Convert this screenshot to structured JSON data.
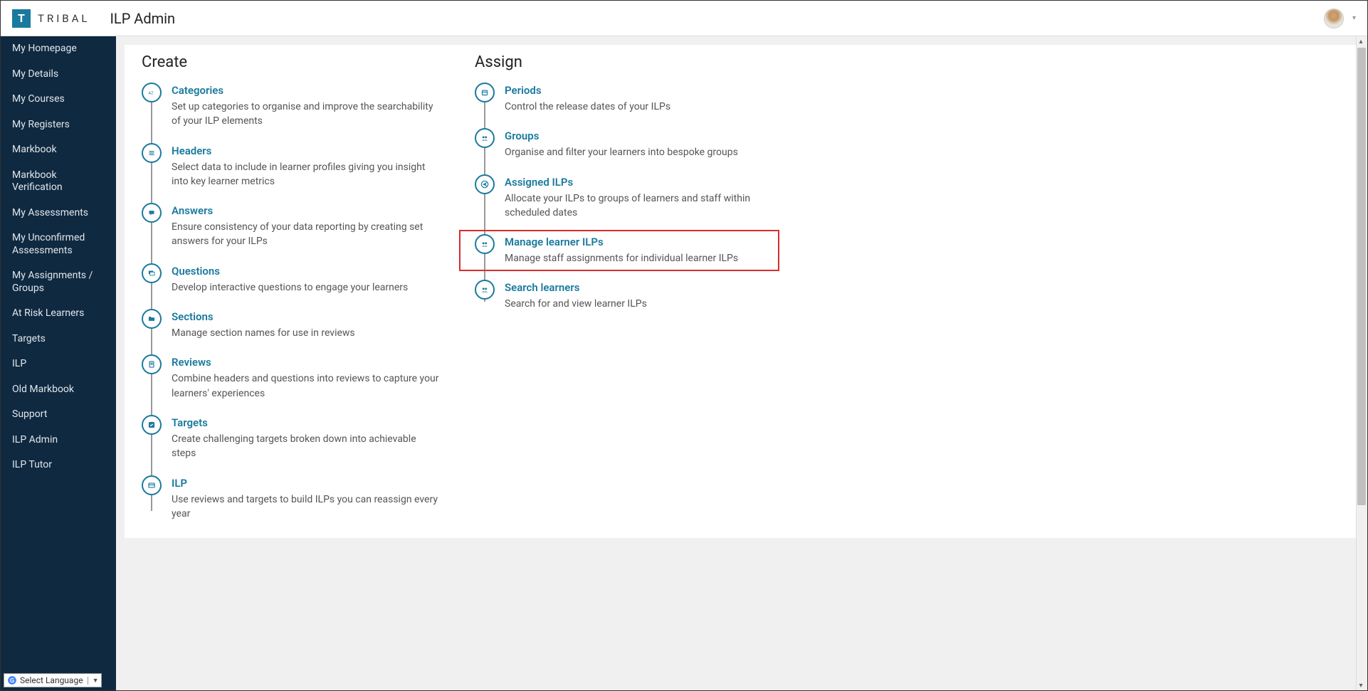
{
  "header": {
    "logo_letter": "T",
    "logo_text": "TRIBAL",
    "page_title": "ILP Admin"
  },
  "sidebar": {
    "items": [
      "My Homepage",
      "My Details",
      "My Courses",
      "My Registers",
      "Markbook",
      "Markbook Verification",
      "My Assessments",
      "My Unconfirmed Assessments",
      "My Assignments / Groups",
      "At Risk Learners",
      "Targets",
      "ILP",
      "Old Markbook",
      "Support",
      "ILP Admin",
      "ILP Tutor"
    ],
    "language_selector": "Select Language"
  },
  "create": {
    "heading": "Create",
    "items": [
      {
        "title": "Categories",
        "desc": "Set up categories to organise and improve the searchability of your ILP elements"
      },
      {
        "title": "Headers",
        "desc": "Select data to include in learner profiles giving you insight into key learner metrics"
      },
      {
        "title": "Answers",
        "desc": "Ensure consistency of your data reporting by creating set answers for your ILPs"
      },
      {
        "title": "Questions",
        "desc": "Develop interactive questions to engage your learners"
      },
      {
        "title": "Sections",
        "desc": "Manage section names for use in reviews"
      },
      {
        "title": "Reviews",
        "desc": "Combine headers and questions into reviews to capture your learners' experiences"
      },
      {
        "title": "Targets",
        "desc": "Create challenging targets broken down into achievable steps"
      },
      {
        "title": "ILP",
        "desc": "Use reviews and targets to build ILPs you can reassign every year"
      }
    ]
  },
  "assign": {
    "heading": "Assign",
    "items": [
      {
        "title": "Periods",
        "desc": "Control the release dates of your ILPs"
      },
      {
        "title": "Groups",
        "desc": "Organise and filter your learners into bespoke groups"
      },
      {
        "title": "Assigned ILPs",
        "desc": "Allocate your ILPs to groups of learners and staff within scheduled dates"
      },
      {
        "title": "Manage learner ILPs",
        "desc": "Manage staff assignments for individual learner ILPs"
      },
      {
        "title": "Search learners",
        "desc": "Search for and view learner ILPs"
      }
    ]
  }
}
